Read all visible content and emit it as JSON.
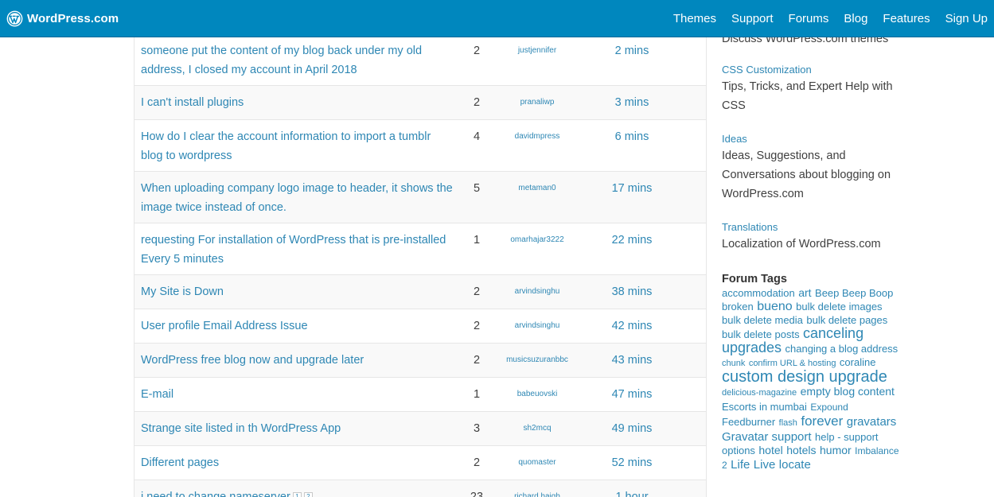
{
  "header": {
    "brand": "WordPress.com",
    "nav": [
      "Themes",
      "Support",
      "Forums",
      "Blog",
      "Features",
      "Sign Up"
    ],
    "bg_color": "#0087be"
  },
  "topics": [
    {
      "title": "someone put the content of my blog back under my old address, I closed my account in April 2018",
      "posts": "2",
      "author": "justjennifer",
      "freshness": "2 mins"
    },
    {
      "title": "I can't install plugins",
      "posts": "2",
      "author": "pranaliwp",
      "freshness": "3 mins"
    },
    {
      "title": "How do I clear the account information to import a tumblr blog to wordpress",
      "posts": "4",
      "author": "davidmpress",
      "freshness": "6 mins"
    },
    {
      "title": "When uploading company logo image to header, it shows the image twice instead of once.",
      "posts": "5",
      "author": "metaman0",
      "freshness": "17 mins"
    },
    {
      "title": "requesting For installation of WordPress that is pre-installed Every 5 minutes",
      "posts": "1",
      "author": "omarhajar3222",
      "freshness": "22 mins"
    },
    {
      "title": "My Site is Down",
      "posts": "2",
      "author": "arvindsinghu",
      "freshness": "38 mins"
    },
    {
      "title": "User profile Email Address Issue",
      "posts": "2",
      "author": "arvindsinghu",
      "freshness": "42 mins"
    },
    {
      "title": "WordPress free blog now and upgrade later",
      "posts": "2",
      "author": "musicsuzuranbbc",
      "freshness": "43 mins"
    },
    {
      "title": "E-mail",
      "posts": "1",
      "author": "babeuovski",
      "freshness": "47 mins"
    },
    {
      "title": "Strange site listed in th WordPress App",
      "posts": "3",
      "author": "sh2mcq",
      "freshness": "49 mins"
    },
    {
      "title": "Different pages",
      "posts": "2",
      "author": "quomaster",
      "freshness": "52 mins"
    },
    {
      "title": "i need to change nameserver",
      "posts": "23",
      "author": "richard.haigh",
      "freshness": "1 hour",
      "pages": [
        "1",
        "2"
      ]
    }
  ],
  "sidebar": {
    "forums": [
      {
        "name": "",
        "desc": "Discuss WordPress.com themes"
      },
      {
        "name": "CSS Customization",
        "desc": "Tips, Tricks, and Expert Help with CSS"
      },
      {
        "name": "Ideas",
        "desc": "Ideas, Suggestions, and Conversations about blogging on WordPress.com"
      },
      {
        "name": "Translations",
        "desc": "Localization of WordPress.com"
      }
    ],
    "tags_heading": "Forum Tags",
    "tags": [
      {
        "label": "accommodation",
        "size": 13
      },
      {
        "label": "art",
        "size": 14
      },
      {
        "label": "Beep Beep Boop",
        "size": 13
      },
      {
        "label": "broken",
        "size": 13
      },
      {
        "label": "bueno",
        "size": 16
      },
      {
        "label": "bulk delete images",
        "size": 13
      },
      {
        "label": "bulk delete media",
        "size": 13
      },
      {
        "label": "bulk delete pages",
        "size": 13
      },
      {
        "label": "bulk delete posts",
        "size": 13
      },
      {
        "label": "canceling upgrades",
        "size": 18
      },
      {
        "label": "changing a blog address",
        "size": 13
      },
      {
        "label": "chunk",
        "size": 11
      },
      {
        "label": "confirm URL & hosting",
        "size": 11
      },
      {
        "label": "coraline",
        "size": 13
      },
      {
        "label": "custom design upgrade",
        "size": 20
      },
      {
        "label": "delicious-magazine",
        "size": 11
      },
      {
        "label": "empty blog content",
        "size": 14
      },
      {
        "label": "Escorts in mumbai",
        "size": 13
      },
      {
        "label": "Expound",
        "size": 12
      },
      {
        "label": "Feedburner",
        "size": 13
      },
      {
        "label": "flash",
        "size": 11
      },
      {
        "label": "forever",
        "size": 17
      },
      {
        "label": "gravatars",
        "size": 15
      },
      {
        "label": "Gravatar support",
        "size": 15
      },
      {
        "label": "help - support options",
        "size": 13
      },
      {
        "label": "hotel",
        "size": 14
      },
      {
        "label": "hotels",
        "size": 14
      },
      {
        "label": "humor",
        "size": 14
      },
      {
        "label": "Imbalance 2",
        "size": 12
      },
      {
        "label": "Life",
        "size": 15
      },
      {
        "label": "Live",
        "size": 15
      },
      {
        "label": "locate",
        "size": 15
      }
    ]
  }
}
